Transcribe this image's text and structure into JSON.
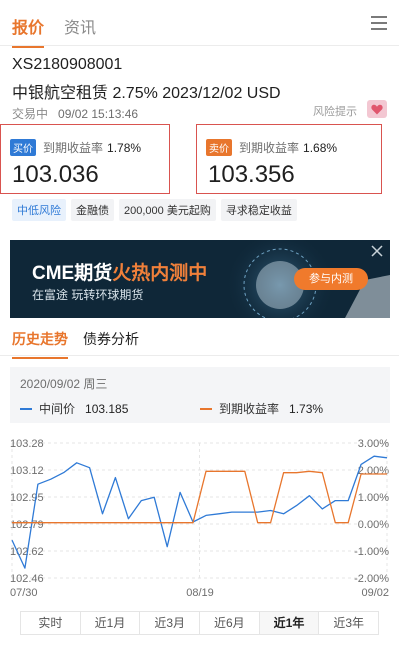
{
  "top_tabs": {
    "quote": "报价",
    "news": "资讯"
  },
  "bond": {
    "code": "XS2180908001",
    "name": "中银航空租赁 2.75% 2023/12/02 USD",
    "status": "交易中",
    "time": "09/02 15:13:46",
    "risk_tip": "风险提示"
  },
  "buy": {
    "badge": "买价",
    "label": "到期收益率",
    "ytm": "1.78%",
    "price": "103.036"
  },
  "sell": {
    "badge": "卖价",
    "label": "到期收益率",
    "ytm": "1.68%",
    "price": "103.356"
  },
  "tags": [
    "中低风险",
    "金融债",
    "200,000 美元起购",
    "寻求稳定收益"
  ],
  "banner": {
    "title_prefix": "CME期货",
    "title_highlight": "火热内测中",
    "subtitle": "在富途  玩转环球期货",
    "button": "参与内测"
  },
  "section_tabs": {
    "history": "历史走势",
    "analysis": "债券分析"
  },
  "chart_info": {
    "date": "2020/09/02 周三",
    "mid_label": "中间价",
    "mid_value": "103.185",
    "ytm_label": "到期收益率",
    "ytm_value": "1.73%"
  },
  "colors": {
    "accent": "#e8762d",
    "mid_line": "#2f7ad6",
    "ytm_line": "#e8762d",
    "alert_border": "#d9534f"
  },
  "chart_data": {
    "type": "line",
    "x_ticks": [
      "07/30",
      "08/19",
      "09/02"
    ],
    "y_left_ticks": [
      "103.28",
      "103.12",
      "102.95",
      "102.79",
      "102.62",
      "102.46"
    ],
    "y_right_ticks": [
      "3.00%",
      "2.00%",
      "1.00%",
      "0.00%",
      "-1.00%",
      "-2.00%"
    ],
    "y_left_range": [
      102.46,
      103.28
    ],
    "y_right_range": [
      -2.0,
      3.0
    ],
    "series": [
      {
        "name": "中间价",
        "axis": "left",
        "values": [
          102.69,
          102.52,
          103.03,
          103.06,
          103.1,
          103.16,
          103.13,
          102.85,
          103.07,
          102.82,
          102.93,
          102.95,
          102.65,
          102.98,
          102.8,
          102.84,
          102.85,
          102.86,
          102.86,
          102.86,
          102.87,
          102.85,
          102.9,
          102.96,
          102.88,
          102.93,
          102.93,
          103.15,
          103.2,
          103.19
        ]
      },
      {
        "name": "到期收益率",
        "axis": "right",
        "values": [
          0.05,
          0.05,
          0.05,
          0.05,
          0.05,
          0.05,
          0.05,
          0.05,
          0.05,
          0.05,
          0.05,
          0.05,
          0.05,
          0.05,
          0.05,
          1.95,
          1.95,
          1.95,
          1.95,
          0.05,
          0.05,
          1.9,
          1.9,
          1.95,
          1.9,
          0.05,
          0.05,
          1.85,
          1.85,
          1.85
        ]
      }
    ]
  },
  "ranges": [
    "实时",
    "近1月",
    "近3月",
    "近6月",
    "近1年",
    "近3年"
  ],
  "active_range": "近1年"
}
